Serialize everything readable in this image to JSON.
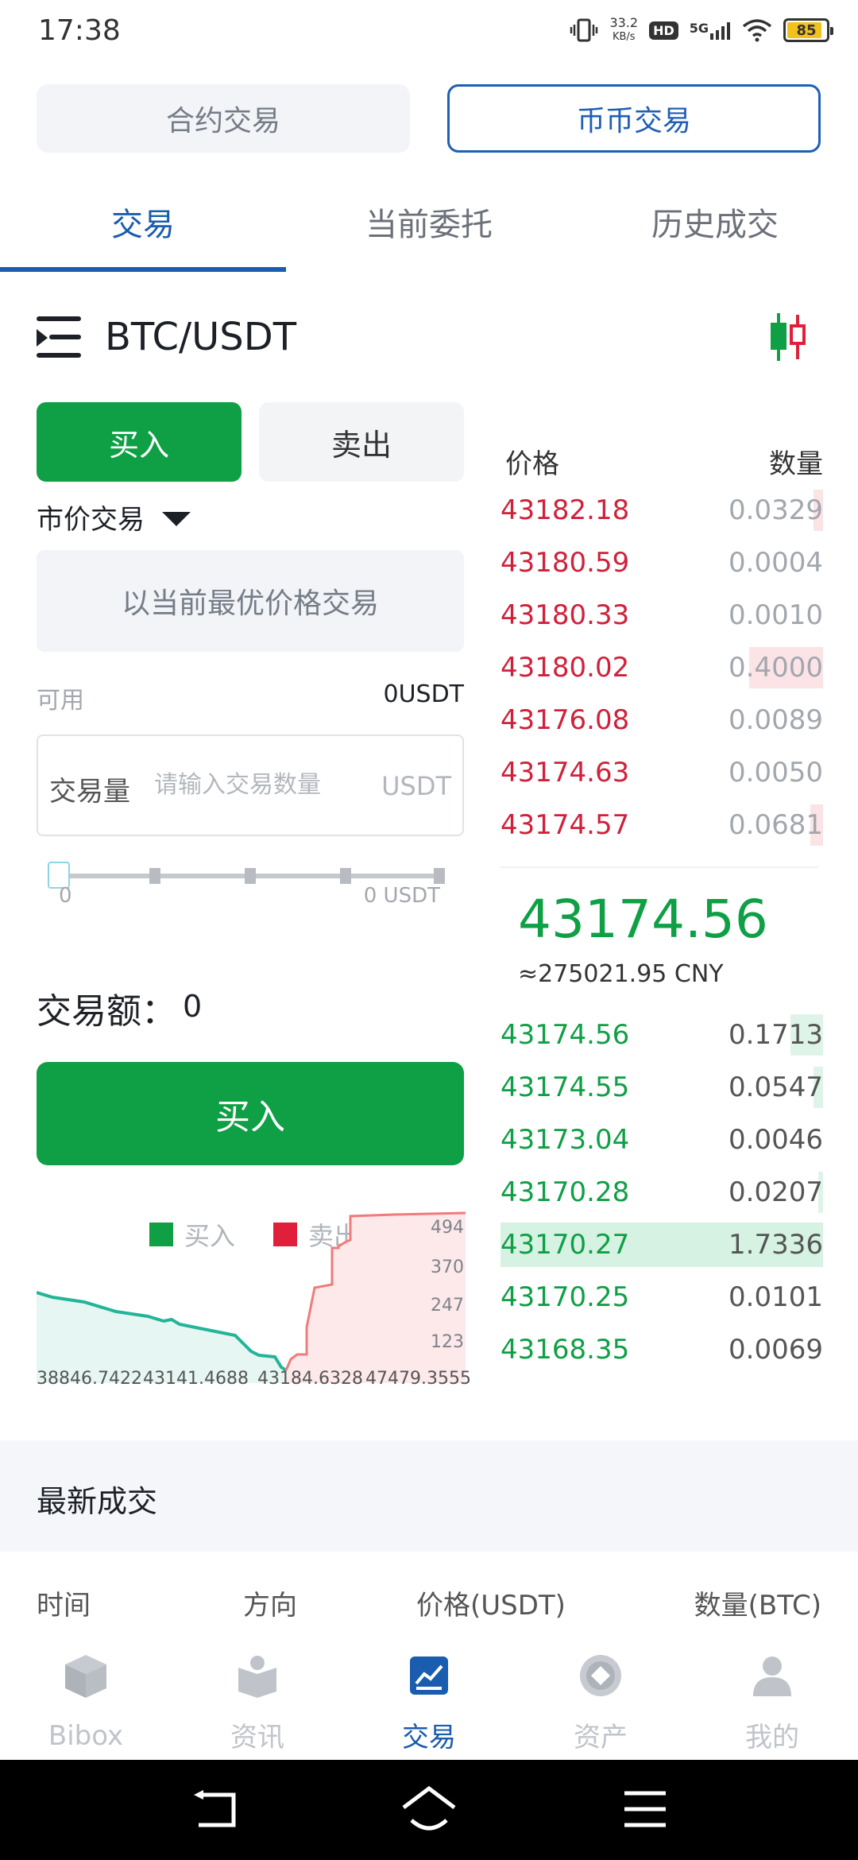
{
  "status": {
    "time": "17:38",
    "speed": "33.2",
    "speed_unit": "KB/s",
    "hd": "HD",
    "net": "5G",
    "battery": "85"
  },
  "top_switch": {
    "contract": "合约交易",
    "spot": "币币交易"
  },
  "tabs": {
    "trade": "交易",
    "current": "当前委托",
    "history": "历史成交"
  },
  "pair": "BTC/USDT",
  "buy_label": "买入",
  "sell_label": "卖出",
  "order_type": "市价交易",
  "best_price_text": "以当前最优价格交易",
  "available": {
    "label": "可用",
    "value": "0USDT"
  },
  "quantity": {
    "label": "交易量",
    "placeholder": "请输入交易数量",
    "unit": "USDT"
  },
  "slider": {
    "min_label": "0",
    "max_label": "0 USDT",
    "value": 0
  },
  "amount": {
    "label": "交易额：",
    "value": "0"
  },
  "buy_button": "买入",
  "depth_chart": {
    "legend": [
      {
        "name": "买入",
        "color": "#0f9f45"
      },
      {
        "name": "卖出",
        "color": "#e0203a"
      }
    ],
    "y_ticks": [
      "494",
      "370",
      "247",
      "123"
    ],
    "x_ticks": [
      "38846.7422",
      "43141.4688",
      "43184.6328",
      "47479.3555"
    ]
  },
  "order_book": {
    "header_price": "价格",
    "header_qty": "数量",
    "asks": [
      {
        "price": "43182.18",
        "qty": "0.0329",
        "depth": 0.03
      },
      {
        "price": "43180.59",
        "qty": "0.0004",
        "depth": 0.0
      },
      {
        "price": "43180.33",
        "qty": "0.0010",
        "depth": 0.0
      },
      {
        "price": "43180.02",
        "qty": "0.4000",
        "depth": 0.23
      },
      {
        "price": "43176.08",
        "qty": "0.0089",
        "depth": 0.0
      },
      {
        "price": "43174.63",
        "qty": "0.0050",
        "depth": 0.0
      },
      {
        "price": "43174.57",
        "qty": "0.0681",
        "depth": 0.04
      }
    ],
    "last_price": "43174.56",
    "last_price_cny": "≈275021.95 CNY",
    "bids": [
      {
        "price": "43174.56",
        "qty": "0.1713",
        "depth": 0.1
      },
      {
        "price": "43174.55",
        "qty": "0.0547",
        "depth": 0.03
      },
      {
        "price": "43173.04",
        "qty": "0.0046",
        "depth": 0.0
      },
      {
        "price": "43170.28",
        "qty": "0.0207",
        "depth": 0.015
      },
      {
        "price": "43170.27",
        "qty": "1.7336",
        "depth": 1.0
      },
      {
        "price": "43170.25",
        "qty": "0.0101",
        "depth": 0.0
      },
      {
        "price": "43168.35",
        "qty": "0.0069",
        "depth": 0.0
      }
    ]
  },
  "latest_trades": {
    "title": "最新成交",
    "headers": [
      "时间",
      "方向",
      "价格(USDT)",
      "数量(BTC)"
    ]
  },
  "bottom_nav": [
    {
      "label": "Bibox",
      "icon": "cube-icon"
    },
    {
      "label": "资讯",
      "icon": "news-icon"
    },
    {
      "label": "交易",
      "icon": "trade-chart-icon"
    },
    {
      "label": "资产",
      "icon": "asset-icon"
    },
    {
      "label": "我的",
      "icon": "user-icon"
    }
  ],
  "colors": {
    "buy_green": "#0f9f45",
    "sell_red": "#d0213b",
    "accent_blue": "#1a5cad"
  }
}
